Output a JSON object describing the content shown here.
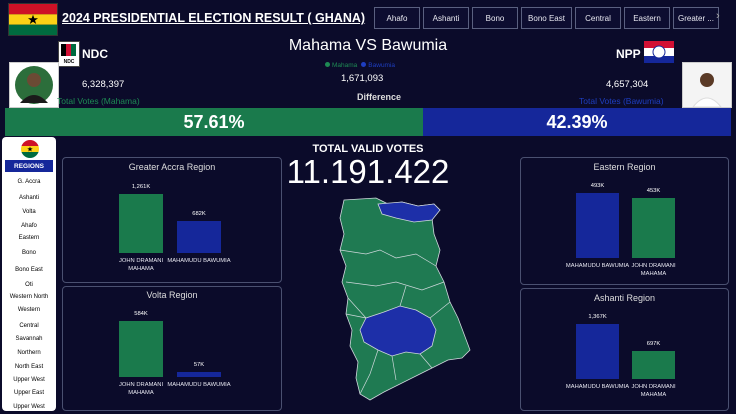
{
  "header": {
    "title": "2024 PRESIDENTIAL ELECTION RESULT ( GHANA)",
    "tabs": [
      "Ahafo",
      "Ashanti",
      "Bono",
      "Bono East",
      "Central",
      "Eastern",
      "Greater ..."
    ]
  },
  "headline": "Mahama VS Bawumia",
  "legend": {
    "a": "Mahama",
    "b": "Bawumia"
  },
  "colors": {
    "ndc_green": "#1a7a4c",
    "npp_blue": "#15279a",
    "background": "#0b0b2a"
  },
  "ndc": {
    "party": "NDC",
    "votes": "6,328,397",
    "label": "Total Votes (Mahama)",
    "logo_text": "NDC"
  },
  "npp": {
    "party": "NPP",
    "votes": "4,657,304",
    "label": "Total Votes (Bawumia)"
  },
  "difference": {
    "value": "1,671,093",
    "label": "Difference"
  },
  "share": {
    "ndc": "57.61%",
    "npp": "42.39%",
    "ndc_fraction": 0.5761
  },
  "total": {
    "label": "TOTAL VALID VOTES",
    "value": "11.191.422"
  },
  "sidebar": {
    "header": "REGIONS",
    "items": [
      "G. Accra",
      "Ashanti",
      "Volta",
      "Ahafo",
      "Eastern",
      "Bono",
      "Bono East",
      "Oti",
      "Western North",
      "Western",
      "Central",
      "Savannah",
      "Northern",
      "North East",
      "Upper West",
      "Upper East",
      "Upper West"
    ]
  },
  "charts": {
    "accra": {
      "title": "Greater Accra Region",
      "bars": [
        {
          "value_label": "1,261K",
          "name": "JOHN DRAMANI MAHAMA"
        },
        {
          "value_label": "682K",
          "name": "MAHAMUDU BAWUMIA"
        }
      ]
    },
    "volta": {
      "title": "Volta Region",
      "bars": [
        {
          "value_label": "584K",
          "name": "JOHN DRAMANI MAHAMA"
        },
        {
          "value_label": "57K",
          "name": "MAHAMUDU BAWUMIA"
        }
      ]
    },
    "eastern": {
      "title": "Eastern Region",
      "bars": [
        {
          "value_label": "493K",
          "name": "MAHAMUDU BAWUMIA"
        },
        {
          "value_label": "453K",
          "name": "JOHN DRAMANI MAHAMA"
        }
      ]
    },
    "ashanti": {
      "title": "Ashanti Region",
      "bars": [
        {
          "value_label": "1,367K",
          "name": "MAHAMUDU BAWUMIA"
        },
        {
          "value_label": "697K",
          "name": "JOHN DRAMANI MAHAMA"
        }
      ]
    }
  },
  "chart_data": [
    {
      "type": "bar",
      "title": "Greater Accra Region",
      "categories": [
        "JOHN DRAMANI MAHAMA",
        "MAHAMUDU BAWUMIA"
      ],
      "values": [
        1261,
        682
      ]
    },
    {
      "type": "bar",
      "title": "Volta Region",
      "categories": [
        "JOHN DRAMANI MAHAMA",
        "MAHAMUDU BAWUMIA"
      ],
      "values": [
        584,
        57
      ]
    },
    {
      "type": "bar",
      "title": "Eastern Region",
      "categories": [
        "MAHAMUDU BAWUMIA",
        "JOHN DRAMANI MAHAMA"
      ],
      "values": [
        493,
        453
      ]
    },
    {
      "type": "bar",
      "title": "Ashanti Region",
      "categories": [
        "MAHAMUDU BAWUMIA",
        "JOHN DRAMANI MAHAMA"
      ],
      "values": [
        1367,
        697
      ]
    }
  ]
}
